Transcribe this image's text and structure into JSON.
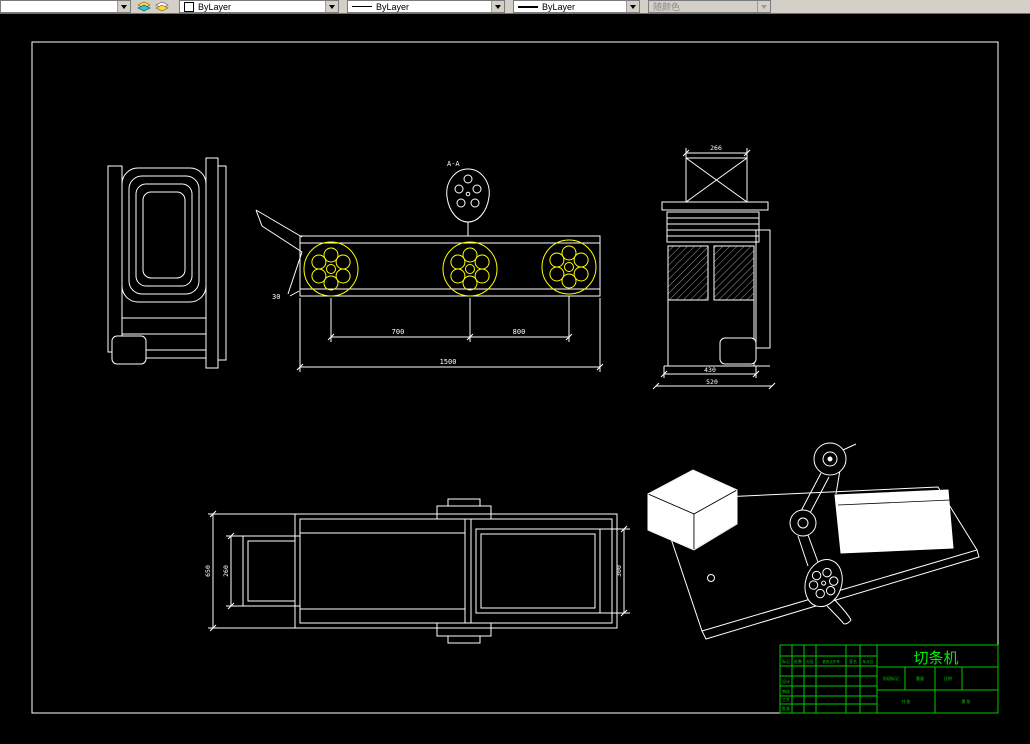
{
  "toolbar": {
    "layer_combo": {
      "value": ""
    },
    "color_combo": {
      "label": "ByLayer"
    },
    "linetype_combo": {
      "label": "ByLayer"
    },
    "lineweight_combo": {
      "label": "ByLayer"
    },
    "plotstyle_combo": {
      "label": "随颜色"
    }
  },
  "drawing": {
    "section_label": "A-A",
    "dims": {
      "front_note": "30",
      "front_span_left": "700",
      "front_span_right": "800",
      "front_total": "1500",
      "side_top": "266",
      "side_bottom_inner": "430",
      "side_bottom_outer": "520",
      "plan_height_outer": "650",
      "plan_height_left": "260",
      "plan_height_right": "300"
    },
    "titleblock": {
      "title": "切条机",
      "labels": [
        "标记",
        "处数",
        "分区",
        "更改文件号",
        "签名",
        "年月日",
        "设计",
        "审核",
        "工艺",
        "批准",
        "阶段标记",
        "重量",
        "比例",
        "共 张",
        "第 张"
      ]
    }
  },
  "colors": {
    "canvas": "#000000",
    "line": "#ffffff",
    "wheel": "#ffff00",
    "titleblock": "#00dd00",
    "toolbar_bg": "#d4d0c8"
  }
}
